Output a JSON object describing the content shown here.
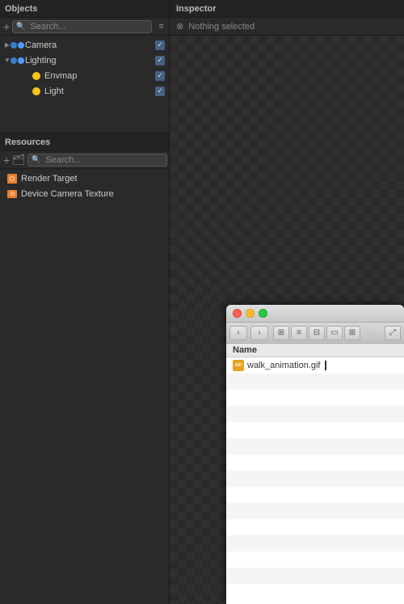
{
  "objects_section": {
    "title": "Objects",
    "search_placeholder": "Search...",
    "items": [
      {
        "label": "Camera",
        "level": 0,
        "type": "camera",
        "has_arrow": true,
        "arrow": "▶",
        "checked": true
      },
      {
        "label": "Lighting",
        "level": 0,
        "type": "folder",
        "has_arrow": true,
        "arrow": "▼",
        "checked": true
      },
      {
        "label": "Envmap",
        "level": 1,
        "type": "envmap",
        "has_arrow": false,
        "arrow": "",
        "checked": true
      },
      {
        "label": "Light",
        "level": 1,
        "type": "light",
        "has_arrow": false,
        "arrow": "",
        "checked": true
      }
    ]
  },
  "inspector_section": {
    "title": "Inspector",
    "nothing_selected": "Nothing selected"
  },
  "resources_section": {
    "title": "Resources",
    "search_placeholder": "Search...",
    "items": [
      {
        "label": "Render Target",
        "type": "render-target"
      },
      {
        "label": "Device Camera Texture",
        "type": "device-camera"
      }
    ]
  },
  "file_browser": {
    "name_header": "Name",
    "files": [
      {
        "name": "walk_animation.gif",
        "type": "gif"
      }
    ],
    "empty_rows": 14
  },
  "toolbar": {
    "plus_label": "+",
    "list_icon": "≡",
    "eye_icon": "◉",
    "filter_icon": "⚙"
  }
}
